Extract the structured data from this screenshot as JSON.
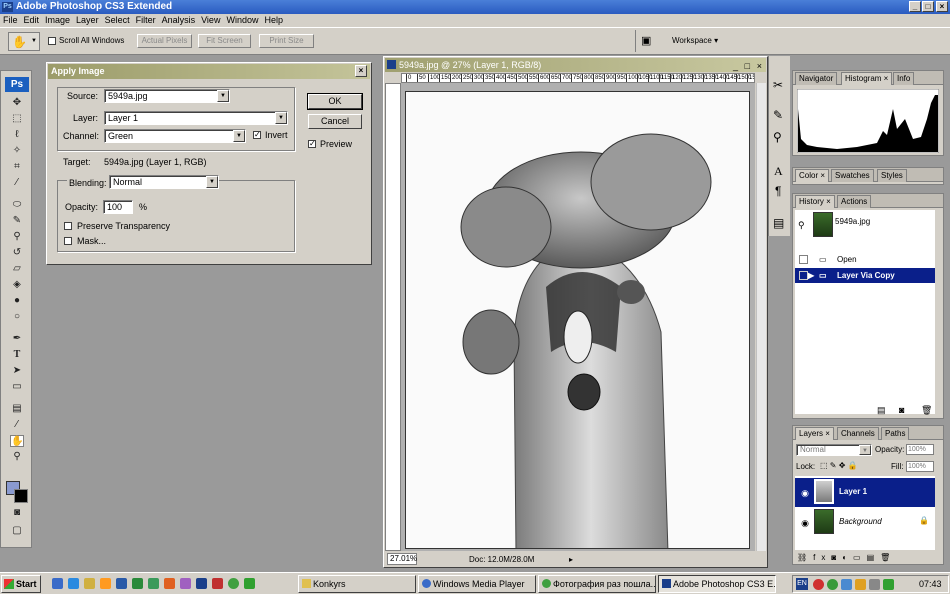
{
  "app": {
    "title": "Adobe Photoshop CS3 Extended"
  },
  "menu": [
    "File",
    "Edit",
    "Image",
    "Layer",
    "Select",
    "Filter",
    "Analysis",
    "View",
    "Window",
    "Help"
  ],
  "options": {
    "scroll_all": "Scroll All Windows",
    "actual_pixels": "Actual Pixels",
    "fit_screen": "Fit Screen",
    "print_size": "Print Size",
    "workspace": "Workspace ▾"
  },
  "dialog": {
    "title": "Apply Image",
    "source_label": "Source:",
    "source_value": "5949a.jpg",
    "layer_label": "Layer:",
    "layer_value": "Layer 1",
    "channel_label": "Channel:",
    "channel_value": "Green",
    "invert": "Invert",
    "target_label": "Target:",
    "target_value": "5949a.jpg (Layer 1, RGB)",
    "blending_label": "Blending:",
    "blending_value": "Normal",
    "opacity_label": "Opacity:",
    "opacity_value": "100",
    "opacity_unit": "%",
    "preserve": "Preserve Transparency",
    "mask": "Mask...",
    "ok": "OK",
    "cancel": "Cancel",
    "preview": "Preview"
  },
  "document": {
    "title": "5949a.jpg @ 27% (Layer 1, RGB/8)",
    "zoom": "27.01%",
    "doc_size": "Doc: 12.0M/28.0M",
    "ruler_top": [
      "0",
      "50",
      "100",
      "150",
      "200",
      "250",
      "300",
      "350",
      "400",
      "450",
      "500",
      "550",
      "600",
      "650",
      "700",
      "750",
      "800",
      "850",
      "900",
      "950",
      "1000",
      "1050",
      "1100",
      "1150",
      "1200",
      "1250",
      "1300",
      "1350",
      "1400",
      "1450",
      "1500",
      "1550",
      "1600"
    ]
  },
  "panels": {
    "nav_tabs": [
      "Navigator",
      "Histogram",
      "Info"
    ],
    "color_tabs": [
      "Color",
      "Swatches",
      "Styles"
    ],
    "history_tabs": [
      "History",
      "Actions"
    ],
    "history_snapshot": "5949a.jpg",
    "history_items": [
      "Open",
      "Layer Via Copy"
    ],
    "layers_tabs": [
      "Layers",
      "Channels",
      "Paths"
    ],
    "blend_mode": "Normal",
    "opacity_label": "Opacity:",
    "opacity_value": "100%",
    "lock_label": "Lock:",
    "fill_label": "Fill:",
    "fill_value": "100%",
    "layers": [
      "Layer 1",
      "Background"
    ]
  },
  "taskbar": {
    "start": "Start",
    "tasks": [
      "Konkyrs",
      "Windows Media Player",
      "Фотография раз пошла...",
      "Adobe Photoshop CS3 E..."
    ],
    "lang": "EN",
    "clock": "07:43"
  },
  "colors": {
    "selection": "#0a1f8a",
    "dialog_title": "#9c9c6a",
    "xp_blue": "#2a5bc0"
  }
}
